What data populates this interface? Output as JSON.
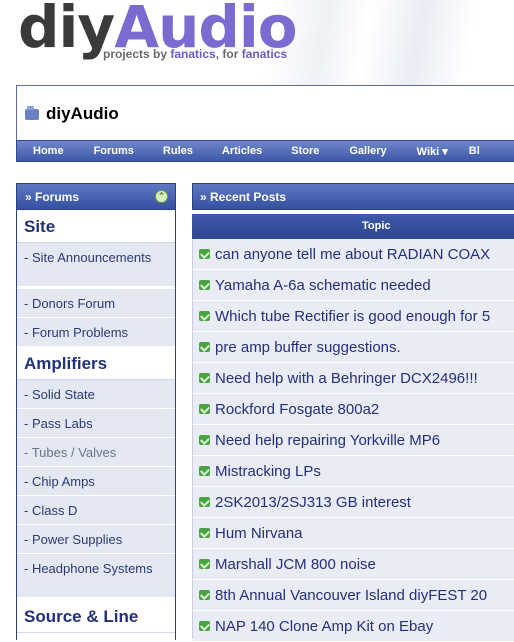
{
  "logo": {
    "part1": "diy",
    "part2": "Audio"
  },
  "tagline": {
    "t1": "projects by ",
    "t2": "fanatics",
    "t3": ", for ",
    "t4": "fanatics"
  },
  "site_title": "diyAudio",
  "nav": [
    {
      "label": "Home"
    },
    {
      "label": "Forums"
    },
    {
      "label": "Rules"
    },
    {
      "label": "Articles"
    },
    {
      "label": "Store"
    },
    {
      "label": "Gallery"
    },
    {
      "label": "Wiki ▾"
    },
    {
      "label": "Bl"
    }
  ],
  "forums_panel": {
    "title": "» Forums",
    "collapse_icon": "collapse-arrow-up",
    "categories": [
      {
        "label": "Site"
      },
      {
        "label": "Amplifiers"
      },
      {
        "label": "Source & Line"
      }
    ],
    "items": [
      {
        "label": "- Site Announcements"
      },
      {
        "label": "- Donors Forum"
      },
      {
        "label": "- Forum Problems"
      },
      {
        "label": "- Solid State"
      },
      {
        "label": "- Pass Labs"
      },
      {
        "label": "- Tubes / Valves"
      },
      {
        "label": "- Chip Amps"
      },
      {
        "label": "- Class D"
      },
      {
        "label": "- Power Supplies"
      },
      {
        "label": "- Headphone Systems"
      }
    ]
  },
  "recent_posts": {
    "title": "» Recent Posts",
    "column_header": "Topic",
    "posts": [
      {
        "title": "can anyone tell me about RADIAN COAX"
      },
      {
        "title": "Yamaha A-6a schematic needed"
      },
      {
        "title": "Which tube Rectifier is good enough for 5"
      },
      {
        "title": "pre amp buffer suggestions."
      },
      {
        "title": "Need help with a Behringer DCX2496!!!"
      },
      {
        "title": "Rockford Fosgate 800a2"
      },
      {
        "title": "Need help repairing Yorkville MP6"
      },
      {
        "title": "Mistracking LPs"
      },
      {
        "title": "2SK2013/2SJ313 GB interest"
      },
      {
        "title": "Hum Nirvana"
      },
      {
        "title": "Marshall JCM 800 noise"
      },
      {
        "title": "8th Annual Vancouver Island diyFEST 20"
      },
      {
        "title": "NAP 140 Clone Amp Kit on Ebay"
      }
    ]
  }
}
